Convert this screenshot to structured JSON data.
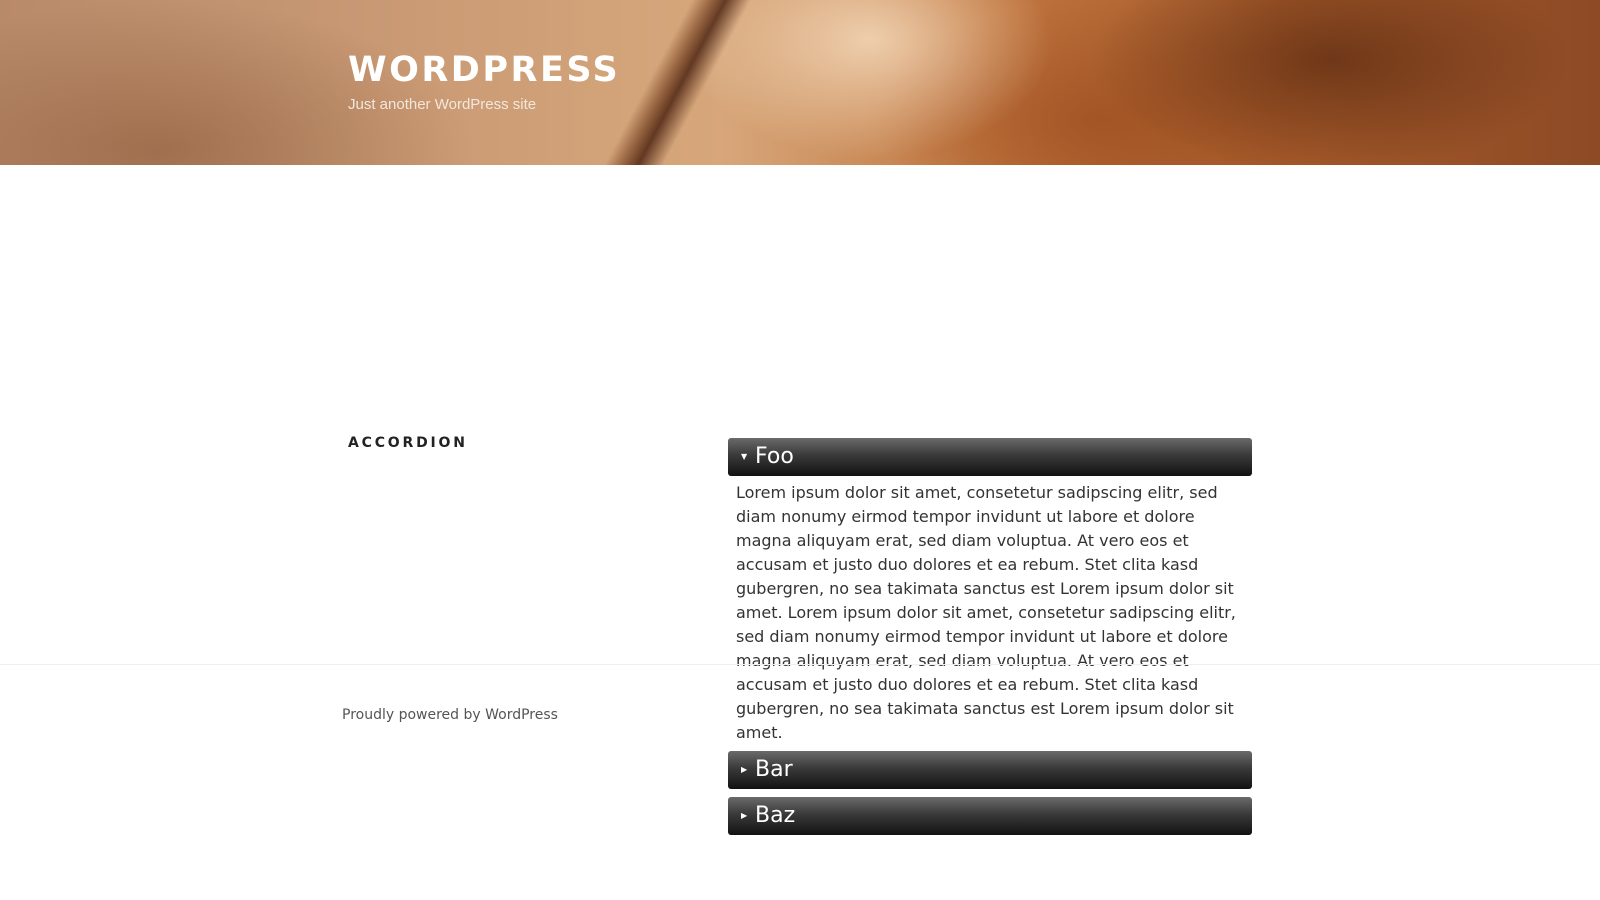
{
  "header": {
    "site_title": "WORDPRESS",
    "tagline": "Just another WordPress site"
  },
  "page": {
    "title": "ACCORDION"
  },
  "accordion": {
    "items": [
      {
        "label": "Foo",
        "expanded": true,
        "body": "Lorem ipsum dolor sit amet, consetetur sadipscing elitr, sed diam nonumy eirmod tempor invidunt ut labore et dolore magna aliquyam erat, sed diam voluptua. At vero eos et accusam et justo duo dolores et ea rebum. Stet clita kasd gubergren, no sea takimata sanctus est Lorem ipsum dolor sit amet. Lorem ipsum dolor sit amet, consetetur sadipscing elitr, sed diam nonumy eirmod tempor invidunt ut labore et dolore magna aliquyam erat, sed diam voluptua. At vero eos et accusam et justo duo dolores et ea rebum. Stet clita kasd gubergren, no sea takimata sanctus est Lorem ipsum dolor sit amet."
      },
      {
        "label": "Bar",
        "expanded": false
      },
      {
        "label": "Baz",
        "expanded": false
      }
    ],
    "arrow_expanded": "▼",
    "arrow_collapsed": "▶"
  },
  "footer": {
    "credit": "Proudly powered by WordPress"
  },
  "icons": {
    "expanded": "triangle-down-icon",
    "collapsed": "triangle-right-icon"
  }
}
